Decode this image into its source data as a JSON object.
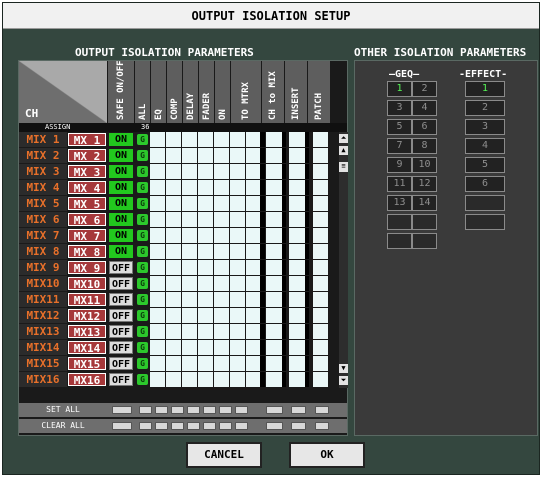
{
  "window": {
    "title": "OUTPUT ISOLATION SETUP"
  },
  "left_section": {
    "title": "OUTPUT ISOLATION PARAMETERS",
    "ch_label": "CH",
    "assign_label": "ASSIGN",
    "assign_count": "36",
    "columns": [
      "SAFE ON/OFF",
      "ALL",
      "EQ",
      "COMP",
      "DELAY",
      "FADER",
      "ON",
      "TO MTRX",
      "CH to MIX",
      "INSERT",
      "PATCH"
    ],
    "rows": [
      {
        "ch": "MIX 1",
        "mx": "MX 1",
        "safe": "ON",
        "g": "G"
      },
      {
        "ch": "MIX 2",
        "mx": "MX 2",
        "safe": "ON",
        "g": "G"
      },
      {
        "ch": "MIX 3",
        "mx": "MX 3",
        "safe": "ON",
        "g": "G"
      },
      {
        "ch": "MIX 4",
        "mx": "MX 4",
        "safe": "ON",
        "g": "G"
      },
      {
        "ch": "MIX 5",
        "mx": "MX 5",
        "safe": "ON",
        "g": "G"
      },
      {
        "ch": "MIX 6",
        "mx": "MX 6",
        "safe": "ON",
        "g": "G"
      },
      {
        "ch": "MIX 7",
        "mx": "MX 7",
        "safe": "ON",
        "g": "G"
      },
      {
        "ch": "MIX 8",
        "mx": "MX 8",
        "safe": "ON",
        "g": "G"
      },
      {
        "ch": "MIX 9",
        "mx": "MX 9",
        "safe": "OFF",
        "g": "G"
      },
      {
        "ch": "MIX10",
        "mx": "MX10",
        "safe": "OFF",
        "g": "G"
      },
      {
        "ch": "MIX11",
        "mx": "MX11",
        "safe": "OFF",
        "g": "G"
      },
      {
        "ch": "MIX12",
        "mx": "MX12",
        "safe": "OFF",
        "g": "G"
      },
      {
        "ch": "MIX13",
        "mx": "MX13",
        "safe": "OFF",
        "g": "G"
      },
      {
        "ch": "MIX14",
        "mx": "MX14",
        "safe": "OFF",
        "g": "G"
      },
      {
        "ch": "MIX15",
        "mx": "MX15",
        "safe": "OFF",
        "g": "G"
      },
      {
        "ch": "MIX16",
        "mx": "MX16",
        "safe": "OFF",
        "g": "G"
      }
    ],
    "set_all": "SET ALL",
    "clear_all": "CLEAR ALL"
  },
  "right_section": {
    "title": "OTHER ISOLATION PARAMETERS",
    "geq_label": "—GEQ—",
    "effect_label": "-EFFECT-",
    "geq_slots": [
      "1",
      "2",
      "3",
      "4",
      "5",
      "6",
      "7",
      "8",
      "9",
      "10",
      "11",
      "12",
      "13",
      "14"
    ],
    "effect_slots": [
      "1",
      "2",
      "3",
      "4",
      "5",
      "6"
    ]
  },
  "buttons": {
    "cancel": "CANCEL",
    "ok": "OK"
  },
  "colors": {
    "background": "#34473f",
    "on_green": "#22c81e",
    "channel_orange": "#e8702a",
    "mx_red": "#a6383a",
    "selected_green": "#55f355"
  }
}
